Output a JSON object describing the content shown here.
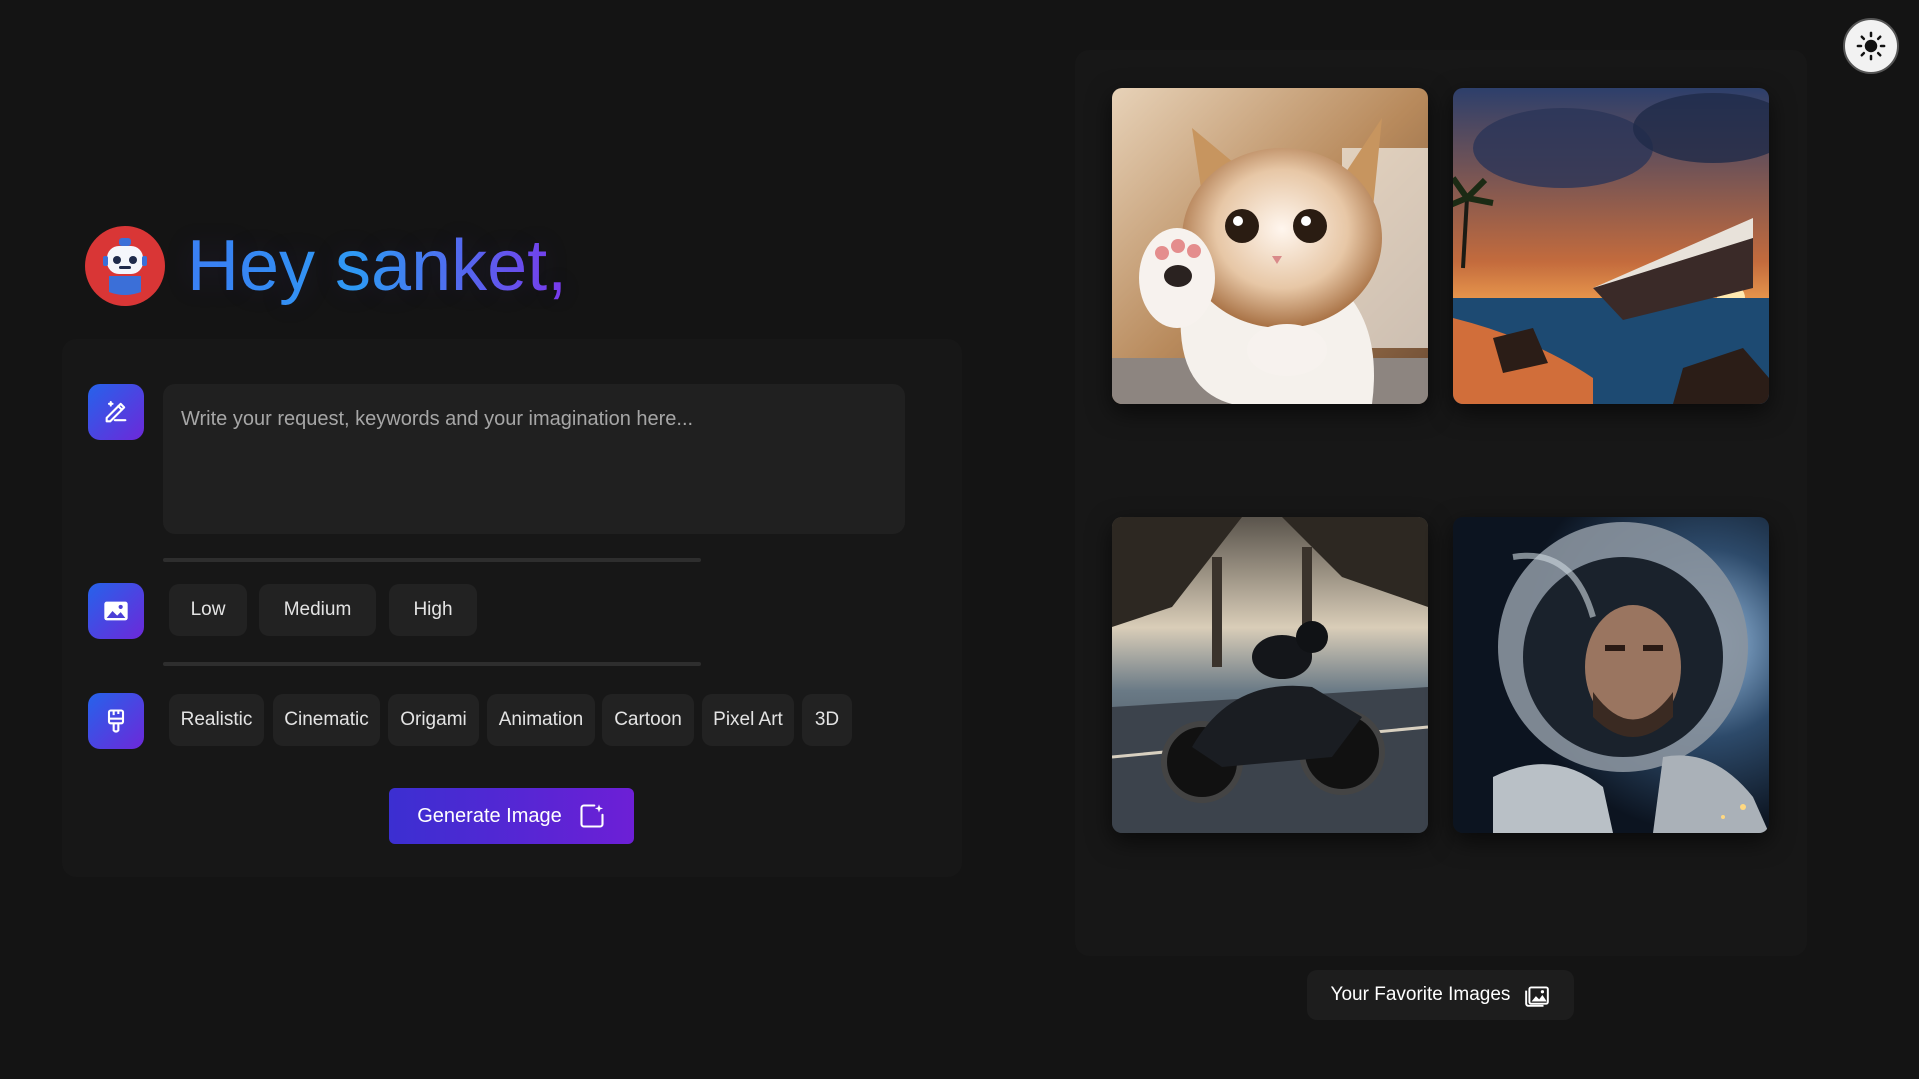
{
  "greeting": {
    "text": "Hey sanket,"
  },
  "prompt": {
    "placeholder": "Write your request, keywords and your imagination here..."
  },
  "quality": {
    "options": [
      "Low",
      "Medium",
      "High"
    ]
  },
  "styles": {
    "options": [
      "Realistic",
      "Cinematic",
      "Origami",
      "Animation",
      "Cartoon",
      "Pixel Art",
      "3D"
    ]
  },
  "generate": {
    "label": "Generate Image"
  },
  "gallery": {
    "images": [
      "cat-waving-paw",
      "cruise-ship-sunset-beach",
      "motorcycle-under-bridge",
      "astronaut-portrait"
    ]
  },
  "favorites": {
    "label": "Your Favorite Images"
  },
  "colors": {
    "accent_start": "#2563eb",
    "accent_end": "#6d28d9",
    "background": "#141414"
  }
}
